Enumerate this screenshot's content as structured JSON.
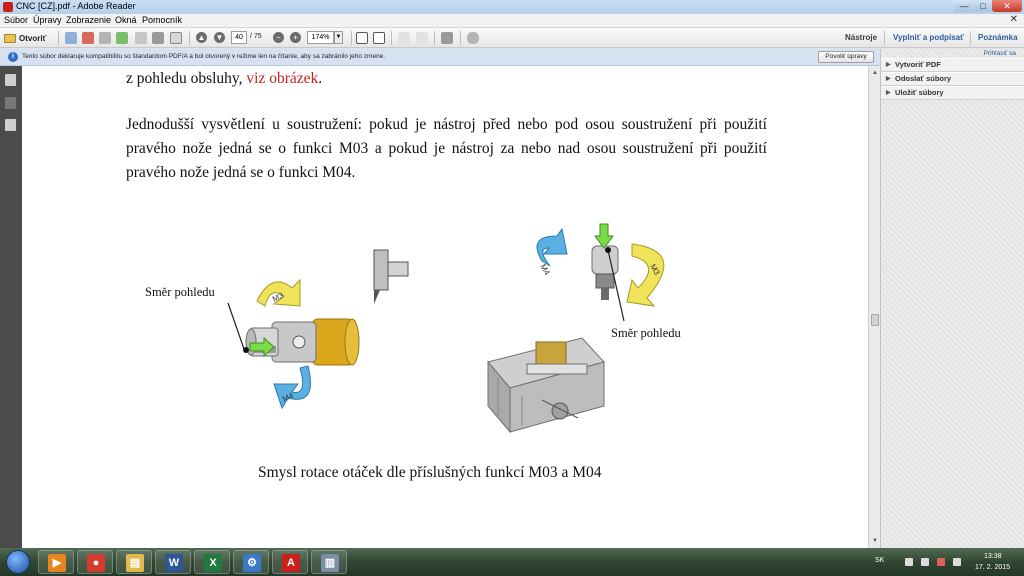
{
  "window": {
    "title": "CNC [CZ].pdf - Adobe Reader",
    "minimize_glyph": "—",
    "maximize_glyph": "□",
    "close_glyph": "✕"
  },
  "menubar": {
    "items": [
      "Súbor",
      "Úpravy",
      "Zobrazenie",
      "Okná",
      "Pomocník"
    ],
    "close_glyph": "✕"
  },
  "toolbar": {
    "open_label": "Otvoriť",
    "current_page": "40",
    "total_pages": "/ 75",
    "zoom": "174%",
    "tools_label": "Nástroje",
    "fill_sign_label": "Vyplniť a podpísať",
    "comment_label": "Poznámka"
  },
  "infobar": {
    "message": "Tento súbor deklaruje kompatibilitu so štandardom PDF/A a bol otvorený v režime len na čítanie, aby sa zabránilo jeho zmene.",
    "enable_button": "Povoliť úpravy"
  },
  "rightpanel": {
    "sign_in": "Prihlásiť sa",
    "items": [
      "Vytvoriť PDF",
      "Odoslať súbory",
      "Uložiť súbory"
    ]
  },
  "document": {
    "line1_text": "z pohledu obsluhy, ",
    "line1_link": "viz obrázek",
    "line1_end": ".",
    "paragraph": "Jednodušší vysvětlení u soustružení: pokud je nástroj před nebo pod osou soustružení při použití pravého nože jedná se o funkci M03 a pokud je nástroj za nebo nad osou soustružení při použití pravého nože jedná se o funkci M04.",
    "figure_left_label": "Směr pohledu",
    "figure_right_label": "Směr pohledu",
    "caption": "Smysl rotace otáček dle příslušných funkcí M03 a M04",
    "arrow_labels": {
      "m3": "M3",
      "m4": "M4"
    }
  },
  "taskbar": {
    "apps": [
      {
        "name": "media-player",
        "glyph": "▶",
        "color": "#e8851e"
      },
      {
        "name": "chrome",
        "glyph": "●",
        "color": "#d53b2e"
      },
      {
        "name": "explorer",
        "glyph": "▤",
        "color": "#e2b94e"
      },
      {
        "name": "word",
        "glyph": "W",
        "color": "#2b5797"
      },
      {
        "name": "excel",
        "glyph": "X",
        "color": "#1f7a3d"
      },
      {
        "name": "control-panel",
        "glyph": "⚙",
        "color": "#3a79c4"
      },
      {
        "name": "adobe-reader",
        "glyph": "A",
        "color": "#c9201c"
      },
      {
        "name": "notepad",
        "glyph": "▥",
        "color": "#7a8ea8"
      }
    ],
    "language": "SK",
    "time": "13:38",
    "date": "17. 2. 2015"
  },
  "colors": {
    "link_red": "#c8221a",
    "accent_blue": "#2a5f9e",
    "arrow_yellow": "#efe35a",
    "arrow_blue": "#5ab0e3",
    "arrow_green": "#7bdc4a",
    "gold": "#d9a61c"
  }
}
